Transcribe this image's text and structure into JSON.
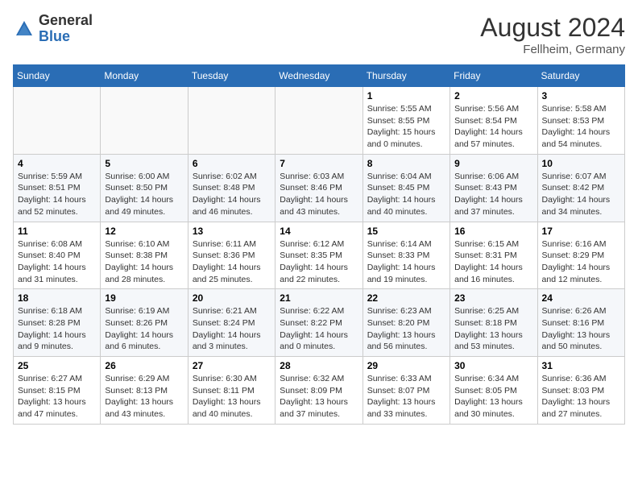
{
  "header": {
    "logo_line1": "General",
    "logo_line2": "Blue",
    "month_year": "August 2024",
    "location": "Fellheim, Germany"
  },
  "calendar": {
    "weekdays": [
      "Sunday",
      "Monday",
      "Tuesday",
      "Wednesday",
      "Thursday",
      "Friday",
      "Saturday"
    ],
    "weeks": [
      [
        {
          "day": "",
          "info": ""
        },
        {
          "day": "",
          "info": ""
        },
        {
          "day": "",
          "info": ""
        },
        {
          "day": "",
          "info": ""
        },
        {
          "day": "1",
          "info": "Sunrise: 5:55 AM\nSunset: 8:55 PM\nDaylight: 15 hours\nand 0 minutes."
        },
        {
          "day": "2",
          "info": "Sunrise: 5:56 AM\nSunset: 8:54 PM\nDaylight: 14 hours\nand 57 minutes."
        },
        {
          "day": "3",
          "info": "Sunrise: 5:58 AM\nSunset: 8:53 PM\nDaylight: 14 hours\nand 54 minutes."
        }
      ],
      [
        {
          "day": "4",
          "info": "Sunrise: 5:59 AM\nSunset: 8:51 PM\nDaylight: 14 hours\nand 52 minutes."
        },
        {
          "day": "5",
          "info": "Sunrise: 6:00 AM\nSunset: 8:50 PM\nDaylight: 14 hours\nand 49 minutes."
        },
        {
          "day": "6",
          "info": "Sunrise: 6:02 AM\nSunset: 8:48 PM\nDaylight: 14 hours\nand 46 minutes."
        },
        {
          "day": "7",
          "info": "Sunrise: 6:03 AM\nSunset: 8:46 PM\nDaylight: 14 hours\nand 43 minutes."
        },
        {
          "day": "8",
          "info": "Sunrise: 6:04 AM\nSunset: 8:45 PM\nDaylight: 14 hours\nand 40 minutes."
        },
        {
          "day": "9",
          "info": "Sunrise: 6:06 AM\nSunset: 8:43 PM\nDaylight: 14 hours\nand 37 minutes."
        },
        {
          "day": "10",
          "info": "Sunrise: 6:07 AM\nSunset: 8:42 PM\nDaylight: 14 hours\nand 34 minutes."
        }
      ],
      [
        {
          "day": "11",
          "info": "Sunrise: 6:08 AM\nSunset: 8:40 PM\nDaylight: 14 hours\nand 31 minutes."
        },
        {
          "day": "12",
          "info": "Sunrise: 6:10 AM\nSunset: 8:38 PM\nDaylight: 14 hours\nand 28 minutes."
        },
        {
          "day": "13",
          "info": "Sunrise: 6:11 AM\nSunset: 8:36 PM\nDaylight: 14 hours\nand 25 minutes."
        },
        {
          "day": "14",
          "info": "Sunrise: 6:12 AM\nSunset: 8:35 PM\nDaylight: 14 hours\nand 22 minutes."
        },
        {
          "day": "15",
          "info": "Sunrise: 6:14 AM\nSunset: 8:33 PM\nDaylight: 14 hours\nand 19 minutes."
        },
        {
          "day": "16",
          "info": "Sunrise: 6:15 AM\nSunset: 8:31 PM\nDaylight: 14 hours\nand 16 minutes."
        },
        {
          "day": "17",
          "info": "Sunrise: 6:16 AM\nSunset: 8:29 PM\nDaylight: 14 hours\nand 12 minutes."
        }
      ],
      [
        {
          "day": "18",
          "info": "Sunrise: 6:18 AM\nSunset: 8:28 PM\nDaylight: 14 hours\nand 9 minutes."
        },
        {
          "day": "19",
          "info": "Sunrise: 6:19 AM\nSunset: 8:26 PM\nDaylight: 14 hours\nand 6 minutes."
        },
        {
          "day": "20",
          "info": "Sunrise: 6:21 AM\nSunset: 8:24 PM\nDaylight: 14 hours\nand 3 minutes."
        },
        {
          "day": "21",
          "info": "Sunrise: 6:22 AM\nSunset: 8:22 PM\nDaylight: 14 hours\nand 0 minutes."
        },
        {
          "day": "22",
          "info": "Sunrise: 6:23 AM\nSunset: 8:20 PM\nDaylight: 13 hours\nand 56 minutes."
        },
        {
          "day": "23",
          "info": "Sunrise: 6:25 AM\nSunset: 8:18 PM\nDaylight: 13 hours\nand 53 minutes."
        },
        {
          "day": "24",
          "info": "Sunrise: 6:26 AM\nSunset: 8:16 PM\nDaylight: 13 hours\nand 50 minutes."
        }
      ],
      [
        {
          "day": "25",
          "info": "Sunrise: 6:27 AM\nSunset: 8:15 PM\nDaylight: 13 hours\nand 47 minutes."
        },
        {
          "day": "26",
          "info": "Sunrise: 6:29 AM\nSunset: 8:13 PM\nDaylight: 13 hours\nand 43 minutes."
        },
        {
          "day": "27",
          "info": "Sunrise: 6:30 AM\nSunset: 8:11 PM\nDaylight: 13 hours\nand 40 minutes."
        },
        {
          "day": "28",
          "info": "Sunrise: 6:32 AM\nSunset: 8:09 PM\nDaylight: 13 hours\nand 37 minutes."
        },
        {
          "day": "29",
          "info": "Sunrise: 6:33 AM\nSunset: 8:07 PM\nDaylight: 13 hours\nand 33 minutes."
        },
        {
          "day": "30",
          "info": "Sunrise: 6:34 AM\nSunset: 8:05 PM\nDaylight: 13 hours\nand 30 minutes."
        },
        {
          "day": "31",
          "info": "Sunrise: 6:36 AM\nSunset: 8:03 PM\nDaylight: 13 hours\nand 27 minutes."
        }
      ]
    ]
  }
}
